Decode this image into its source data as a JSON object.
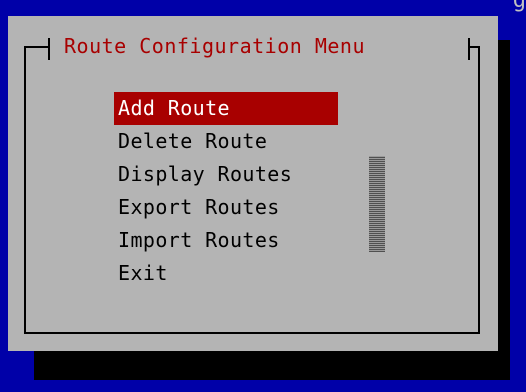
{
  "header_fragment": "g",
  "dialog": {
    "title": "Route Configuration Menu",
    "menu_items": [
      {
        "label": "Add Route",
        "selected": true
      },
      {
        "label": "Delete Route",
        "selected": false
      },
      {
        "label": "Display Routes",
        "selected": false
      },
      {
        "label": "Export Routes",
        "selected": false
      },
      {
        "label": "Import Routes",
        "selected": false
      },
      {
        "label": "Exit",
        "selected": false
      }
    ]
  },
  "colors": {
    "screen_background": "#0000a8",
    "dialog_background": "#b4b4b4",
    "title_text": "#a80000",
    "selection_background": "#a80000",
    "selection_text": "#ffffff",
    "item_text": "#000000",
    "shadow": "#000000"
  }
}
